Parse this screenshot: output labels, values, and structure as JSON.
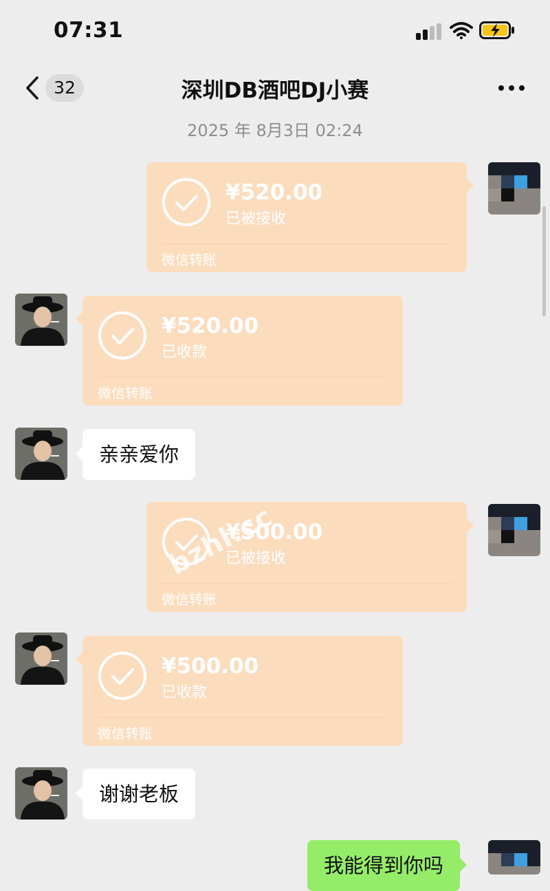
{
  "status_bar": {
    "time": "07:31",
    "icons": [
      "signal-icon",
      "wifi-icon",
      "battery-charging-icon"
    ]
  },
  "nav": {
    "back_icon": "chevron-left-icon",
    "unread_count": "32",
    "title": "深圳DB酒吧DJ小赛",
    "more_icon": "more-horizontal-icon"
  },
  "chat": {
    "timestamp": "2025 年 8月3日 02:24",
    "messages": [
      {
        "type": "transfer",
        "side": "right",
        "amount": "¥520.00",
        "state": "已被接收",
        "footer": "微信转账"
      },
      {
        "type": "transfer",
        "side": "left",
        "amount": "¥520.00",
        "state": "已收款",
        "footer": "微信转账"
      },
      {
        "type": "text",
        "side": "left",
        "text": "亲亲爱你"
      },
      {
        "type": "transfer",
        "side": "right",
        "amount": "¥500.00",
        "state": "已被接收",
        "footer": "微信转账"
      },
      {
        "type": "transfer",
        "side": "left",
        "amount": "¥500.00",
        "state": "已收款",
        "footer": "微信转账"
      },
      {
        "type": "text",
        "side": "left",
        "text": "谢谢老板"
      },
      {
        "type": "text",
        "side": "right",
        "text": "我能得到你吗"
      }
    ]
  },
  "watermark": "bzhl.cc",
  "colors": {
    "background": "#ededed",
    "transfer_card": "#fbdcbd",
    "incoming_bubble": "#ffffff",
    "outgoing_bubble": "#95ec69",
    "timestamp_text": "#8e8e8e",
    "battery_charging": "#f5c518"
  }
}
